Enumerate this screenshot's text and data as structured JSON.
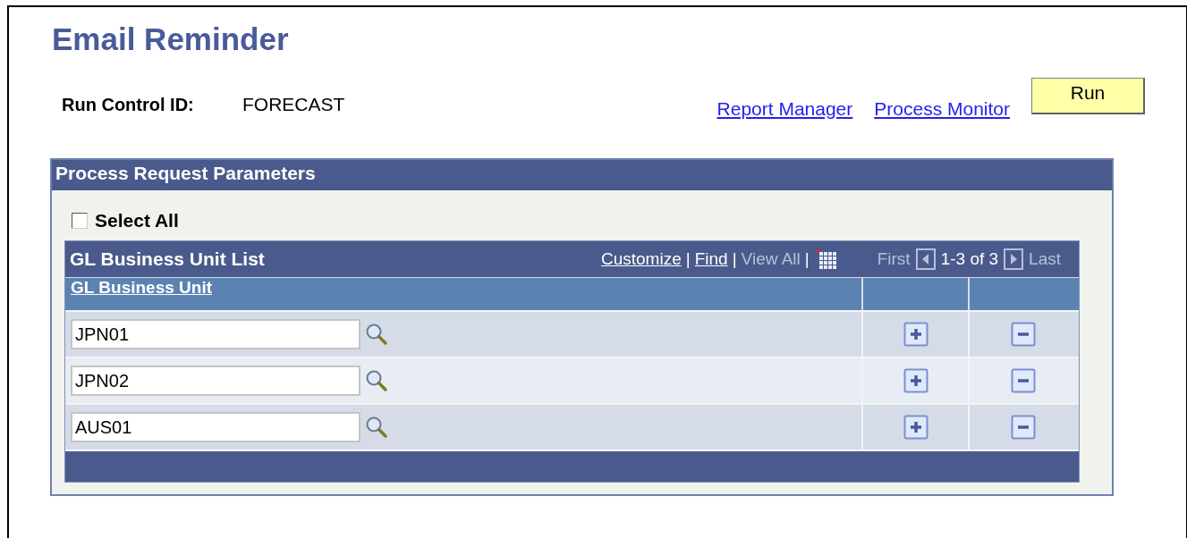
{
  "page_title": "Email Reminder",
  "run_control": {
    "label": "Run Control ID:",
    "value": "FORECAST"
  },
  "links": [
    "Report Manager",
    "Process Monitor"
  ],
  "run_button": "Run",
  "panel": {
    "title": "Process Request Parameters",
    "select_all": {
      "label": "Select All",
      "checked": false
    },
    "grid": {
      "title": "GL Business Unit List",
      "toolbar": [
        {
          "label": "Customize",
          "kind": "link"
        },
        {
          "label": "|",
          "kind": "separator"
        },
        {
          "label": "Find",
          "kind": "link"
        },
        {
          "label": "|",
          "kind": "separator"
        },
        {
          "label": "View All",
          "kind": "disabled"
        },
        {
          "label": "|",
          "kind": "separator"
        },
        {
          "kind": "download"
        }
      ],
      "nav": {
        "first": "First",
        "range": "1-3 of 3",
        "last": "Last"
      },
      "columns": [
        "GL Business Unit"
      ],
      "rows": [
        {
          "value": "JPN01"
        },
        {
          "value": "JPN02"
        },
        {
          "value": "AUS01"
        }
      ]
    }
  }
}
